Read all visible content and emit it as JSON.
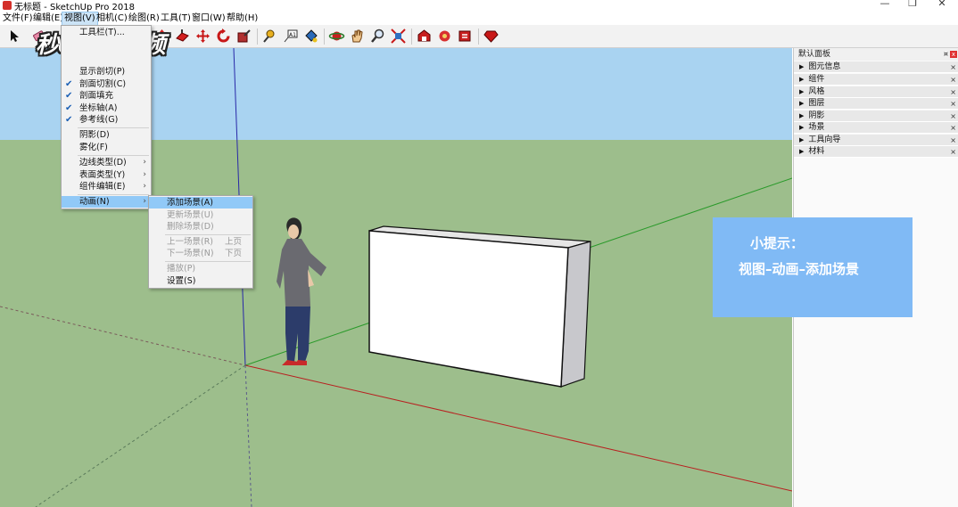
{
  "window": {
    "title": "无标题 - SketchUp Pro 2018",
    "minimize": "—",
    "maximize": "❐",
    "close": "✕"
  },
  "menubar": {
    "items": [
      "文件(F)",
      "编辑(E)",
      "视图(V)",
      "相机(C)",
      "绘图(R)",
      "工具(T)",
      "窗口(W)",
      "帮助(H)"
    ],
    "active": "视图(V)"
  },
  "watermark": "秒dong视频",
  "view_menu": {
    "items": [
      {
        "label": "工具栏(T)...",
        "checked": false,
        "submenu": false
      },
      {
        "label": "显示剖切(P)",
        "checked": false,
        "submenu": false
      },
      {
        "label": "剖面切割(C)",
        "checked": true,
        "submenu": false
      },
      {
        "label": "剖面填充",
        "checked": true,
        "submenu": false
      },
      {
        "label": "坐标轴(A)",
        "checked": true,
        "submenu": false
      },
      {
        "label": "参考线(G)",
        "checked": true,
        "submenu": false
      },
      {
        "label": "阴影(D)",
        "checked": false,
        "submenu": false
      },
      {
        "label": "雾化(F)",
        "checked": false,
        "submenu": false
      },
      {
        "label": "边线类型(D)",
        "checked": false,
        "submenu": true
      },
      {
        "label": "表面类型(Y)",
        "checked": false,
        "submenu": true
      },
      {
        "label": "组件编辑(E)",
        "checked": false,
        "submenu": true
      },
      {
        "label": "动画(N)",
        "checked": false,
        "submenu": true,
        "highlighted": true
      }
    ]
  },
  "animation_submenu": {
    "items": [
      {
        "label": "添加场景(A)",
        "enabled": true,
        "highlighted": true,
        "shortcut": ""
      },
      {
        "label": "更新场景(U)",
        "enabled": false,
        "shortcut": ""
      },
      {
        "label": "删除场景(D)",
        "enabled": false,
        "shortcut": ""
      },
      {
        "label": "上一场景(R)",
        "enabled": false,
        "shortcut": "上页"
      },
      {
        "label": "下一场景(N)",
        "enabled": false,
        "shortcut": "下页"
      },
      {
        "label": "播放(P)",
        "enabled": false,
        "shortcut": ""
      },
      {
        "label": "设置(S)",
        "enabled": true,
        "shortcut": ""
      }
    ]
  },
  "tray": {
    "title": "默认面板",
    "pin": "¤",
    "close": "x",
    "panels": [
      "图元信息",
      "组件",
      "风格",
      "图层",
      "阴影",
      "场景",
      "工具向导",
      "材料"
    ]
  },
  "tip": {
    "title": "小提示：",
    "body": "视图–动画–添加场景"
  },
  "colors": {
    "sky": "#a9d3f1",
    "ground": "#9dbe8c",
    "menu_highlight": "#91c9f7",
    "tip_bg": "#80baf5",
    "check": "#1a5fb4"
  }
}
